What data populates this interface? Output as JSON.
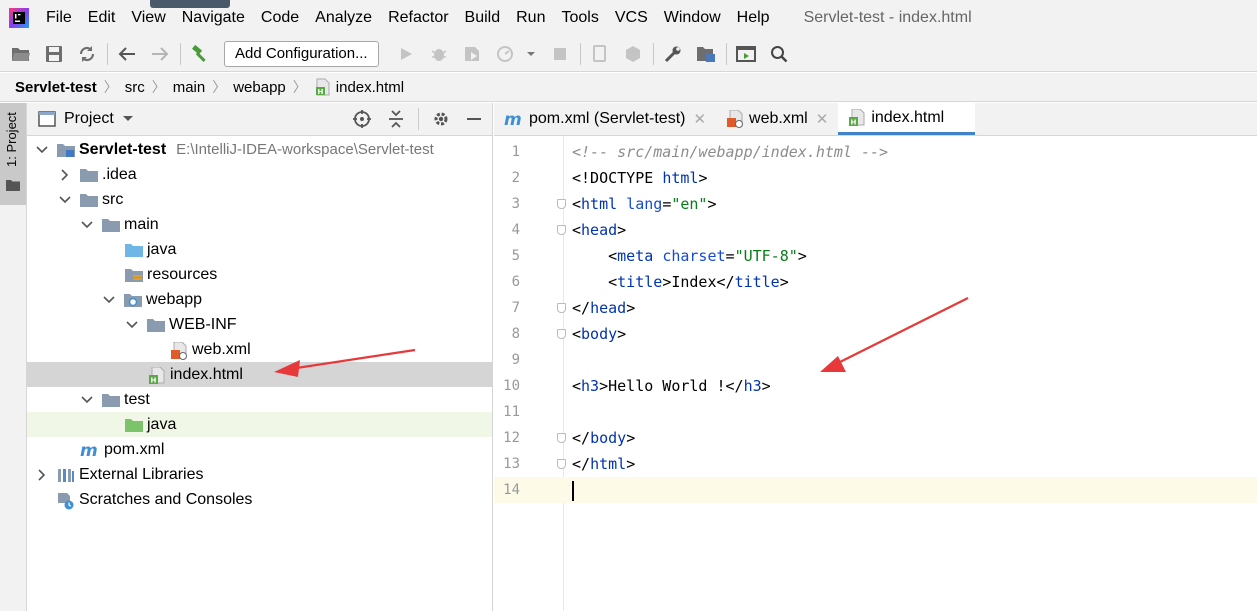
{
  "app": {
    "window_title": "Servlet-test - index.html"
  },
  "menu": [
    "File",
    "Edit",
    "View",
    "Navigate",
    "Code",
    "Analyze",
    "Refactor",
    "Build",
    "Run",
    "Tools",
    "VCS",
    "Window",
    "Help"
  ],
  "toolbar": {
    "add_configuration_label": "Add Configuration..."
  },
  "breadcrumb": [
    "Servlet-test",
    "src",
    "main",
    "webapp",
    "index.html"
  ],
  "left_strip": {
    "project_tab_label": "1: Project"
  },
  "project_panel": {
    "title": "Project",
    "tree": [
      {
        "label": "Servlet-test",
        "path": "E:\\IntelliJ-IDEA-workspace\\Servlet-test",
        "icon": "module-folder-icon",
        "expanded": true
      },
      {
        "label": ".idea",
        "icon": "folder-icon",
        "expanded": false
      },
      {
        "label": "src",
        "icon": "folder-icon",
        "expanded": true
      },
      {
        "label": "main",
        "icon": "folder-icon",
        "expanded": true
      },
      {
        "label": "java",
        "icon": "source-folder-icon"
      },
      {
        "label": "resources",
        "icon": "resources-folder-icon"
      },
      {
        "label": "webapp",
        "icon": "web-folder-icon",
        "expanded": true
      },
      {
        "label": "WEB-INF",
        "icon": "folder-icon",
        "expanded": true
      },
      {
        "label": "web.xml",
        "icon": "xml-file-icon"
      },
      {
        "label": "index.html",
        "icon": "html-file-icon",
        "selected": true
      },
      {
        "label": "test",
        "icon": "folder-icon",
        "expanded": true
      },
      {
        "label": "java",
        "icon": "test-folder-icon"
      },
      {
        "label": "pom.xml",
        "icon": "maven-icon"
      },
      {
        "label": "External Libraries",
        "icon": "libraries-icon",
        "expanded": false
      },
      {
        "label": "Scratches and Consoles",
        "icon": "scratches-icon"
      }
    ]
  },
  "editor": {
    "tabs": [
      {
        "label": "pom.xml (Servlet-test)",
        "icon": "maven-icon",
        "active": false
      },
      {
        "label": "web.xml",
        "icon": "xml-file-icon",
        "active": false
      },
      {
        "label": "index.html",
        "icon": "html-file-icon",
        "active": true
      }
    ],
    "line_numbers": [
      "1",
      "2",
      "3",
      "4",
      "5",
      "6",
      "7",
      "8",
      "9",
      "10",
      "11",
      "12",
      "13",
      "14"
    ],
    "lines": [
      [
        [
          "comment",
          "<!-- src/main/webapp/index.html -->"
        ]
      ],
      [
        [
          "txt",
          "<!DOCTYPE "
        ],
        [
          "kw",
          "html"
        ],
        [
          "txt",
          ">"
        ]
      ],
      [
        [
          "txt",
          "<"
        ],
        [
          "kw",
          "html "
        ],
        [
          "attr",
          "lang"
        ],
        [
          "txt",
          "="
        ],
        [
          "str",
          "\"en\""
        ],
        [
          "txt",
          ">"
        ]
      ],
      [
        [
          "txt",
          "<"
        ],
        [
          "kw",
          "head"
        ],
        [
          "txt",
          ">"
        ]
      ],
      [
        [
          "txt",
          "    <"
        ],
        [
          "kw",
          "meta "
        ],
        [
          "attr",
          "charset"
        ],
        [
          "txt",
          "="
        ],
        [
          "str",
          "\"UTF-8\""
        ],
        [
          "txt",
          ">"
        ]
      ],
      [
        [
          "txt",
          "    <"
        ],
        [
          "kw",
          "title"
        ],
        [
          "txt",
          ">Index</"
        ],
        [
          "kw",
          "title"
        ],
        [
          "txt",
          ">"
        ]
      ],
      [
        [
          "txt",
          "</"
        ],
        [
          "kw",
          "head"
        ],
        [
          "txt",
          ">"
        ]
      ],
      [
        [
          "txt",
          "<"
        ],
        [
          "kw",
          "body"
        ],
        [
          "txt",
          ">"
        ]
      ],
      [],
      [
        [
          "txt",
          "<"
        ],
        [
          "kw",
          "h3"
        ],
        [
          "txt",
          ">Hello World !</"
        ],
        [
          "kw",
          "h3"
        ],
        [
          "txt",
          ">"
        ]
      ],
      [],
      [
        [
          "txt",
          "</"
        ],
        [
          "kw",
          "body"
        ],
        [
          "txt",
          ">"
        ]
      ],
      [
        [
          "txt",
          "</"
        ],
        [
          "kw",
          "html"
        ],
        [
          "txt",
          ">"
        ]
      ],
      []
    ]
  },
  "colors": {
    "accent": "#4083c9",
    "annotation_red": "#e8393a",
    "html_tag": "#0033b3",
    "attr_value": "#067d17",
    "comment": "#8c8c8c"
  }
}
